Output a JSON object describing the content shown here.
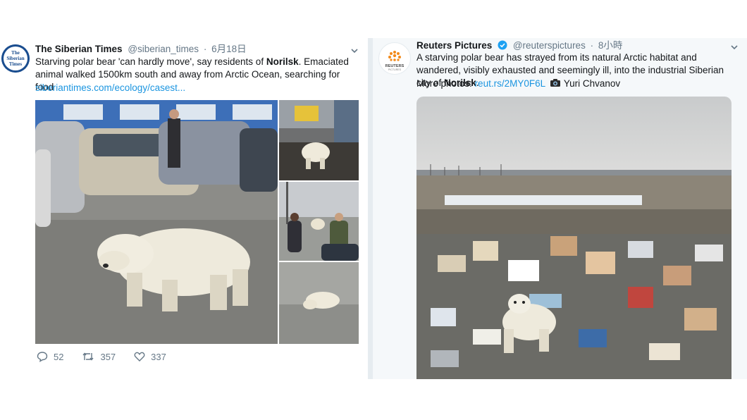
{
  "left_tweet": {
    "author_name": "The Siberian Times",
    "handle": "@siberian_times",
    "separator": "·",
    "time": "6月18日",
    "avatar_text": [
      "The",
      "Siberian",
      "Times"
    ],
    "text_before": "Starving polar bear 'can hardly move', say residents of ",
    "text_bold": "Norilsk",
    "text_after": ". Emaciated animal walked 1500km south and away from Arctic Ocean, searching for food",
    "link": "siberiantimes.com/ecology/casest...",
    "stats": {
      "replies": "52",
      "retweets": "357",
      "likes": "337"
    },
    "icons": [
      "reply-icon",
      "retweet-icon",
      "like-icon",
      "chevron-down-icon"
    ]
  },
  "right_tweet": {
    "author_name": "Reuters Pictures",
    "handle": "@reuterspictures",
    "separator": "·",
    "time": "8小時",
    "avatar_text": "REUTERS",
    "avatar_subtext": "PICTURES",
    "text_before": "A starving polar bear has strayed from its natural Arctic habitat and wandered, visibly exhausted and seemingly ill, into the industrial Siberian city of ",
    "text_bold": "Norilsk",
    "text_after": ".",
    "more_label": "More photos:",
    "more_link": "reut.rs/2MY0F6L",
    "photographer": "Yuri Chvanov",
    "icons": [
      "verified-icon",
      "camera-icon",
      "chevron-down-icon"
    ]
  },
  "colors": {
    "link": "#1b95e0",
    "secondary": "#657786",
    "verified": "#1da1f2",
    "right_bg": "#f5f8fa"
  }
}
